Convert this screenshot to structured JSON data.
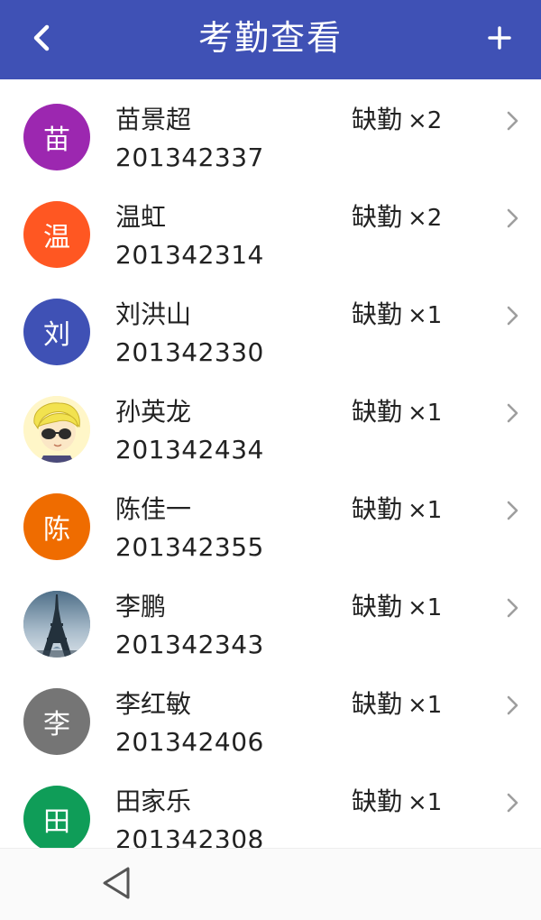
{
  "header": {
    "title": "考勤查看",
    "back_icon": "chevron-left-icon",
    "add_icon": "plus-icon",
    "background": "#3f51b5"
  },
  "students": [
    {
      "name": "苗景超",
      "id": "201342337",
      "absence_label": "缺勤",
      "count": "×2",
      "avatar_text": "苗",
      "avatar_color": "#9c27b0"
    },
    {
      "name": "温虹",
      "id": "201342314",
      "absence_label": "缺勤",
      "count": "×2",
      "avatar_text": "温",
      "avatar_color": "#ff5722"
    },
    {
      "name": "刘洪山",
      "id": "201342330",
      "absence_label": "缺勤",
      "count": "×1",
      "avatar_text": "刘",
      "avatar_color": "#3f51b5"
    },
    {
      "name": "孙英龙",
      "id": "201342434",
      "absence_label": "缺勤",
      "count": "×1",
      "avatar_text": "",
      "avatar_color": "#fff6c8"
    },
    {
      "name": "陈佳一",
      "id": "201342355",
      "absence_label": "缺勤",
      "count": "×1",
      "avatar_text": "陈",
      "avatar_color": "#ef6c00"
    },
    {
      "name": "李鹏",
      "id": "201342343",
      "absence_label": "缺勤",
      "count": "×1",
      "avatar_text": "",
      "avatar_color": "#6d8aa0"
    },
    {
      "name": "李红敏",
      "id": "201342406",
      "absence_label": "缺勤",
      "count": "×1",
      "avatar_text": "李",
      "avatar_color": "#757575"
    },
    {
      "name": "田家乐",
      "id": "201342308",
      "absence_label": "缺勤",
      "count": "×1",
      "avatar_text": "田",
      "avatar_color": "#0f9d58"
    }
  ],
  "nav": {
    "back_icon": "triangle-back-icon"
  }
}
